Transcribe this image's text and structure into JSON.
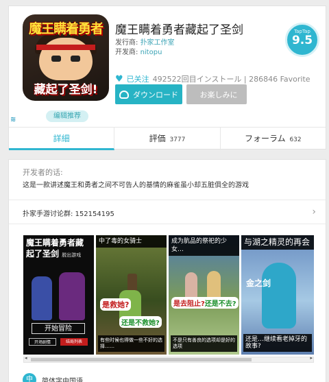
{
  "app": {
    "icon_title": "魔王瞒着勇者",
    "icon_subtitle": "藏起了圣剑!",
    "title": "魔王瞒着勇者藏起了圣剑",
    "publisher_label": "发行商:",
    "publisher": "扑家工作室",
    "developer_label": "开发商:",
    "developer": "nitopu",
    "badge": "编辑推荐"
  },
  "score": {
    "tag": "TapTap",
    "value": "9.5"
  },
  "stats": {
    "follow_label": "已关注",
    "text": "492522回目インストール | 286846 Favorite"
  },
  "buttons": {
    "download": "ダウンロード",
    "fun": "お楽しみに"
  },
  "tabs": [
    {
      "label": "詳細",
      "count": ""
    },
    {
      "label": "評価",
      "count": "3777"
    },
    {
      "label": "フォーラム",
      "count": "632"
    }
  ],
  "description": {
    "dev_label": "开发者的话:",
    "dev_text": "这是一款讲述魔王和勇者之间不可告人的基情的麻雀虽小却五脏俱全的游戏",
    "qq_group": "扑家手游讨论群: 152154195"
  },
  "screenshots": [
    {
      "title": "魔王瞒着勇者藏起了圣剑",
      "sub": "脱出游戏",
      "start": "开始冒险",
      "btn_a": "开场剧情",
      "btn_b": "结局列表"
    },
    {
      "title": "中了毒的女骑士",
      "bubble_a": "是救她?",
      "bubble_b": "还是不救她?",
      "foot": "有些时候也得做一些不好的选择……"
    },
    {
      "title": "成为肮品的祭祀的少女…",
      "bubble_a": "是去阻止?",
      "bubble_b": "还是不去?",
      "foot": "不是只有善良的选项却是好的选项"
    },
    {
      "title": "与湖之精灵的再会",
      "bubble_a": "金之剑",
      "foot": "还是…继续看老掉牙的故事?"
    }
  ],
  "language": {
    "badge": "中",
    "text": "简体字中国语"
  },
  "colors": {
    "accent": "#2fb6d0",
    "download_button": "#27b3c4",
    "disabled_button": "#bdbdbd"
  }
}
